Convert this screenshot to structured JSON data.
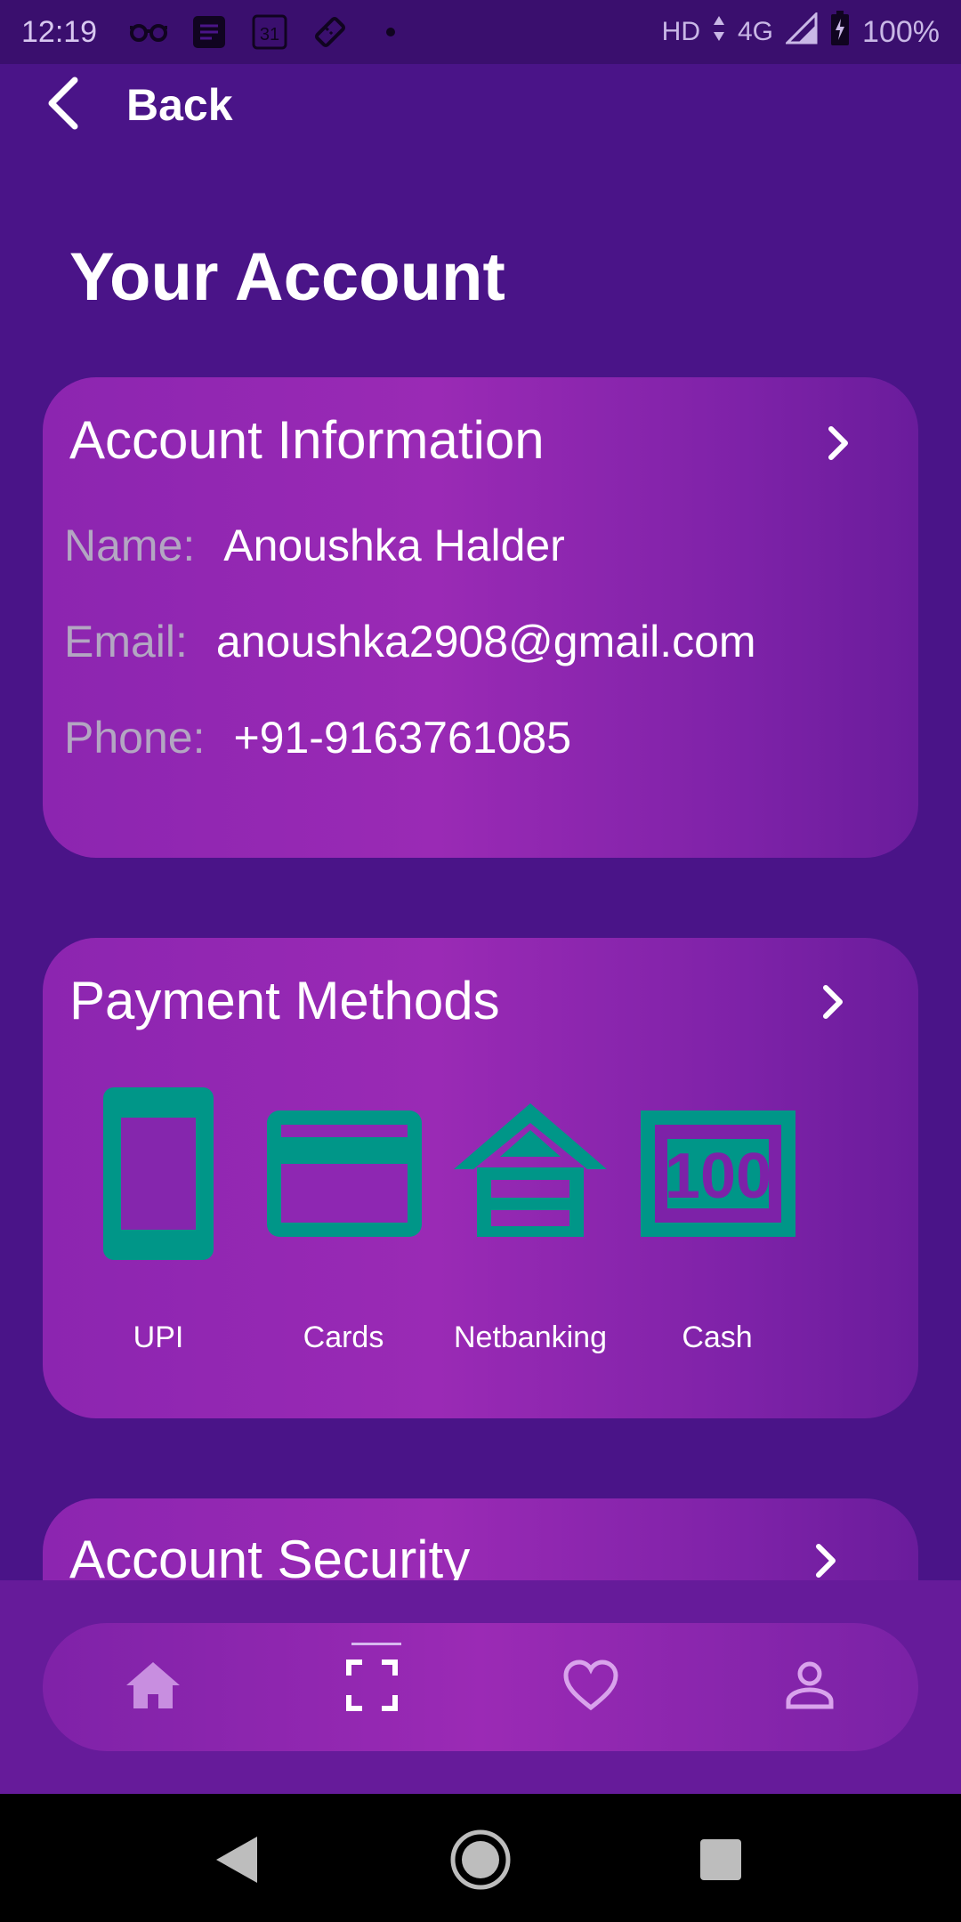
{
  "status_bar": {
    "time": "12:19",
    "left_icons": [
      "glasses-icon",
      "notes-icon",
      "calendar-icon",
      "ticket-icon",
      "dot-icon"
    ],
    "calendar_day": "31",
    "network_hd": "HD",
    "network_type": "4G",
    "battery": "100%"
  },
  "header": {
    "back_label": "Back",
    "title": "Your Account"
  },
  "account_info": {
    "title": "Account Information",
    "rows": [
      {
        "key": "Name:",
        "value": "Anoushka Halder"
      },
      {
        "key": "Email:",
        "value": "anoushka2908@gmail.com"
      },
      {
        "key": "Phone:",
        "value": "+91-9163761085"
      }
    ]
  },
  "payment_methods": {
    "title": "Payment Methods",
    "icon_color": "#009688",
    "items": [
      {
        "label": "UPI",
        "icon": "phone-icon"
      },
      {
        "label": "Cards",
        "icon": "card-icon"
      },
      {
        "label": "Netbanking",
        "icon": "bank-icon"
      },
      {
        "label": "Cash",
        "icon": "cash-icon",
        "icon_text": "100"
      }
    ]
  },
  "account_security": {
    "title": "Account Security"
  },
  "bottom_nav": {
    "items": [
      "home-icon",
      "scan-icon",
      "heart-icon",
      "profile-icon"
    ],
    "active": "scan-icon"
  },
  "colors": {
    "background": "#4a1488",
    "card_gradient": [
      "#8c25b0",
      "#9a2ab5",
      "#6a1c9c"
    ],
    "accent_teal": "#009688"
  }
}
